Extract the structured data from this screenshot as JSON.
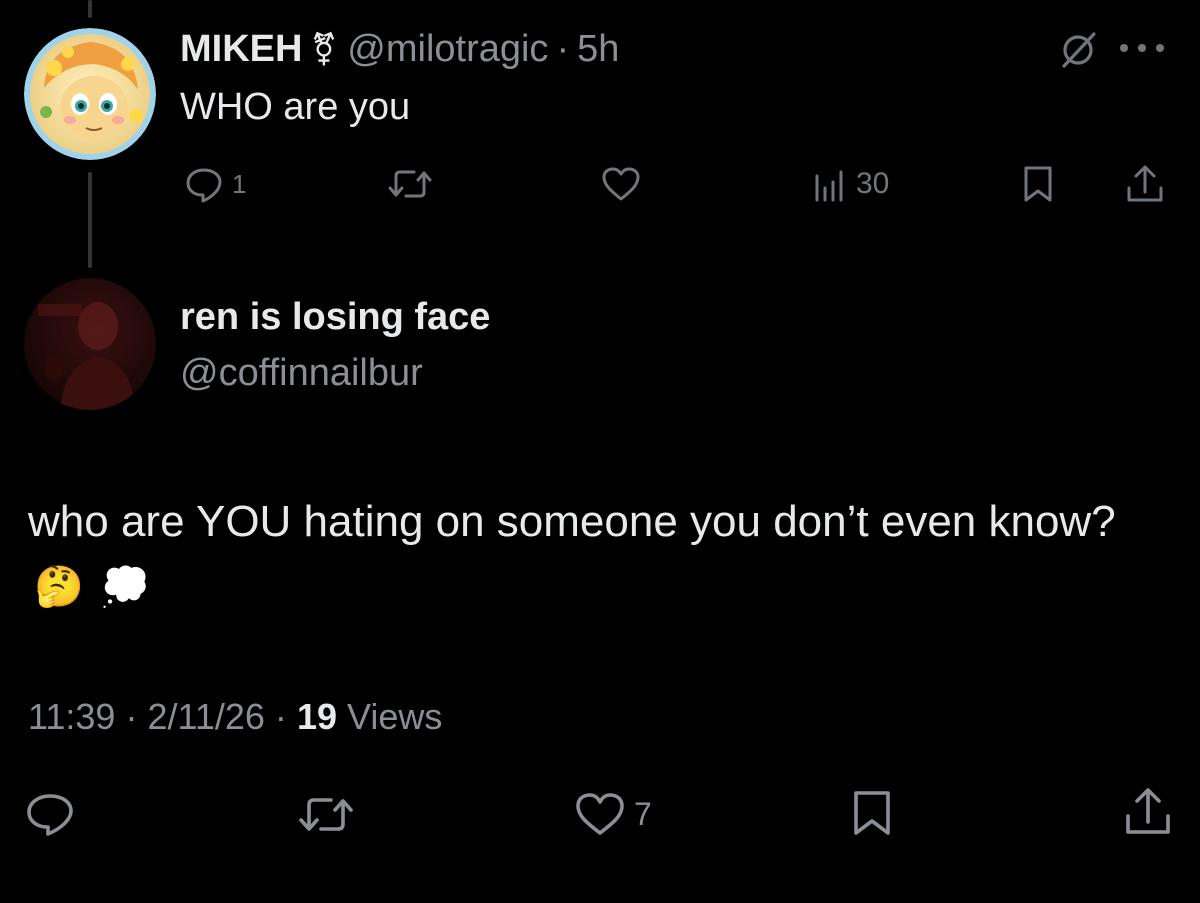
{
  "parent_tweet": {
    "display_name": "MIKEH",
    "gender_symbol": "⚧",
    "handle": "@milotragic",
    "separator": "·",
    "time_ago": "5h",
    "text": "WHO are you",
    "reply_count": "1",
    "views_count": "30",
    "avatar_icon": "pony-avatar",
    "header_icons": [
      "grok-icon",
      "more-icon"
    ]
  },
  "main_tweet": {
    "display_name": "ren is losing face",
    "handle": "@coffinnailbur",
    "text": "who are YOU hating on someone you don’t even know?",
    "emojis": [
      "🤔",
      "💭"
    ],
    "time": "11:39",
    "dot1": "·",
    "date": "2/11/26",
    "dot2": "·",
    "views_count": "19",
    "views_label": "Views",
    "like_count": "7",
    "avatar_icon": "dark-photo-avatar"
  },
  "colors": {
    "background": "#000000",
    "primary_text": "#e7e9ea",
    "secondary_text": "#8b8f94",
    "icon": "#71767b",
    "thread_line": "#333639"
  }
}
